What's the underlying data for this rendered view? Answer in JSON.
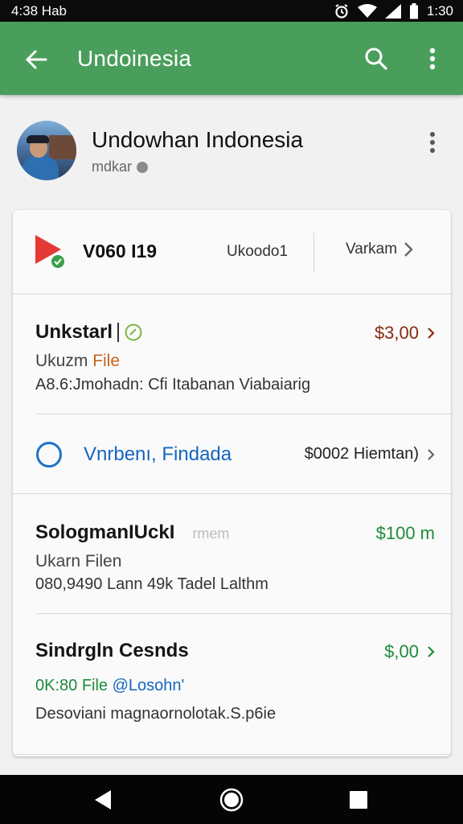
{
  "status_bar": {
    "left_text": "4:38 Hab",
    "time": "1:30",
    "icons": [
      "alarm-icon",
      "wifi-icon",
      "signal-icon",
      "battery-icon"
    ]
  },
  "app_bar": {
    "title": "Undoinesia",
    "icons": [
      "back-arrow-icon",
      "search-icon",
      "more-vert-icon"
    ],
    "color": "#4a9e5c"
  },
  "profile": {
    "name": "Undowhan Indonesia",
    "subtitle": "mdkar"
  },
  "card": {
    "header": {
      "title": "V060 I19",
      "middle": "Ukoodo1",
      "right": "Varkam"
    },
    "items": [
      {
        "title": "Unkstarl",
        "subtitle_prefix": "Ukuzm ",
        "subtitle_accent": "File",
        "description": "A8.6:Jmohadn: Cfi Itabanan Viabaiarig",
        "price": "$3,00"
      },
      {
        "title": "Vnrbenı, Findada",
        "price": "$0002 Hiemtan)"
      },
      {
        "title": "SologmanIUckI",
        "title_hint": "rmem",
        "subtitle": "Ukarn Filen",
        "description": "080,9490 Lann 49k Tadel Lalthm",
        "price": "$100 m"
      },
      {
        "title": "Sindrgln Cesnds",
        "subtitle_green": "0K:80 File",
        "subtitle_blue": "@Losohn'",
        "description": "Desoviani magnaornolotak.S.p6ie",
        "price": "$,00"
      }
    ]
  },
  "colors": {
    "green": "#1e8c3a",
    "blue": "#1565c0",
    "brown": "#8b2a10",
    "orange": "#c8601a",
    "red": "#e53935"
  }
}
